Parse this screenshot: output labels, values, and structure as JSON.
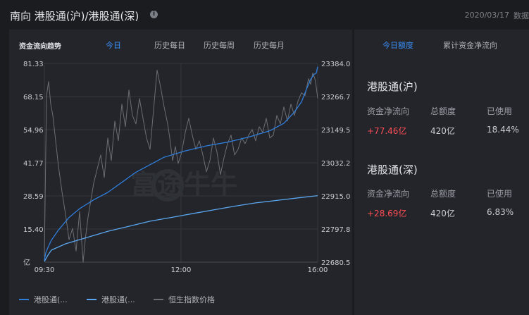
{
  "header": {
    "title": "南向 港股通(沪)/港股通(深)",
    "date": "2020/03/17",
    "source": "数据"
  },
  "left": {
    "label": "资金流向趋势",
    "tabs": [
      "今日",
      "历史每日",
      "历史每周",
      "历史每月"
    ],
    "active_tab": 0
  },
  "chart_data": {
    "type": "line",
    "x_ticks": [
      "09:30",
      "12:00",
      "16:00"
    ],
    "y_left_ticks": [
      "81.33",
      "68.15",
      "54.96",
      "41.77",
      "28.59",
      "15.40",
      "亿"
    ],
    "y_left_range": [
      2.21,
      81.33
    ],
    "y_right_ticks": [
      "23384.0",
      "23266.7",
      "23149.5",
      "23032.2",
      "22915.0",
      "22797.8",
      "22680.5"
    ],
    "y_right_range": [
      22680.5,
      23384.0
    ],
    "grid": true,
    "watermark": "富途牛牛",
    "series": [
      {
        "name": "港股通(...",
        "axis": "left",
        "color": "#2f7ddb",
        "x": [
          0,
          2,
          5,
          10,
          20,
          35,
          50,
          70,
          90,
          110,
          130,
          150,
          170,
          200,
          230,
          260,
          290,
          320,
          340,
          355,
          365,
          372,
          378,
          383,
          386,
          388
        ],
        "y": [
          3,
          6,
          8,
          11,
          15,
          20,
          23.5,
          27,
          30,
          34,
          38,
          41,
          44,
          46.5,
          48.5,
          50,
          52,
          54.5,
          57.5,
          62,
          66,
          71,
          75,
          77,
          77.5,
          80
        ]
      },
      {
        "name": "港股通(...",
        "axis": "left",
        "color": "#5aa6f0",
        "x": [
          0,
          5,
          10,
          30,
          60,
          90,
          120,
          150,
          180,
          210,
          240,
          270,
          300,
          330,
          360,
          388
        ],
        "y": [
          2.5,
          5,
          7,
          9.5,
          12,
          14.5,
          16.5,
          18.5,
          20,
          21.5,
          23,
          24.5,
          25.8,
          26.8,
          27.8,
          28.7
        ]
      },
      {
        "name": "恒生指数价格",
        "axis": "right",
        "color": "#6b6e74",
        "x": [
          0,
          3,
          6,
          9,
          12,
          16,
          20,
          25,
          30,
          35,
          40,
          45,
          50,
          55,
          58,
          62,
          66,
          70,
          75,
          80,
          85,
          90,
          95,
          100,
          105,
          110,
          115,
          120,
          125,
          130,
          135,
          140,
          145,
          150,
          155,
          160,
          165,
          170,
          175,
          178,
          182,
          186,
          190,
          195,
          200,
          205,
          210,
          215,
          220,
          225,
          230,
          235,
          240,
          245,
          250,
          255,
          260,
          265,
          270,
          275,
          280,
          285,
          290,
          295,
          300,
          305,
          310,
          315,
          320,
          325,
          330,
          335,
          340,
          345,
          350,
          355,
          360,
          365,
          370,
          375,
          378,
          381,
          384,
          386,
          388
        ],
        "y": [
          22700,
          23270,
          23320,
          23240,
          23200,
          23110,
          23020,
          22930,
          22850,
          22760,
          22800,
          22720,
          22860,
          22680,
          22760,
          22840,
          22900,
          22960,
          23010,
          23060,
          22980,
          23120,
          23040,
          23180,
          23110,
          23240,
          23160,
          23290,
          23200,
          23170,
          23260,
          23190,
          23120,
          23080,
          23220,
          23360,
          23300,
          23230,
          23170,
          23120,
          23040,
          23090,
          23030,
          23070,
          23140,
          23190,
          23130,
          23080,
          23110,
          23060,
          23000,
          23040,
          23120,
          23070,
          22990,
          23050,
          23100,
          23130,
          23060,
          23080,
          23120,
          23100,
          23130,
          23150,
          23110,
          23160,
          23140,
          23190,
          23120,
          23130,
          23200,
          23170,
          23230,
          23180,
          23240,
          23200,
          23250,
          23280,
          23270,
          23330,
          23310,
          23350,
          23330,
          23300,
          23260
        ]
      }
    ]
  },
  "right": {
    "tabs": [
      "今日额度",
      "累计资金净流向"
    ],
    "active_tab": 0,
    "blocks": [
      {
        "title": "港股通(沪)",
        "headers": [
          "资金净流向",
          "总额度",
          "已使用"
        ],
        "values": [
          "+77.46亿",
          "420亿",
          "18.44%"
        ]
      },
      {
        "title": "港股通(深)",
        "headers": [
          "资金净流向",
          "总额度",
          "已使用"
        ],
        "values": [
          "+28.69亿",
          "420亿",
          "6.83%"
        ]
      }
    ]
  }
}
